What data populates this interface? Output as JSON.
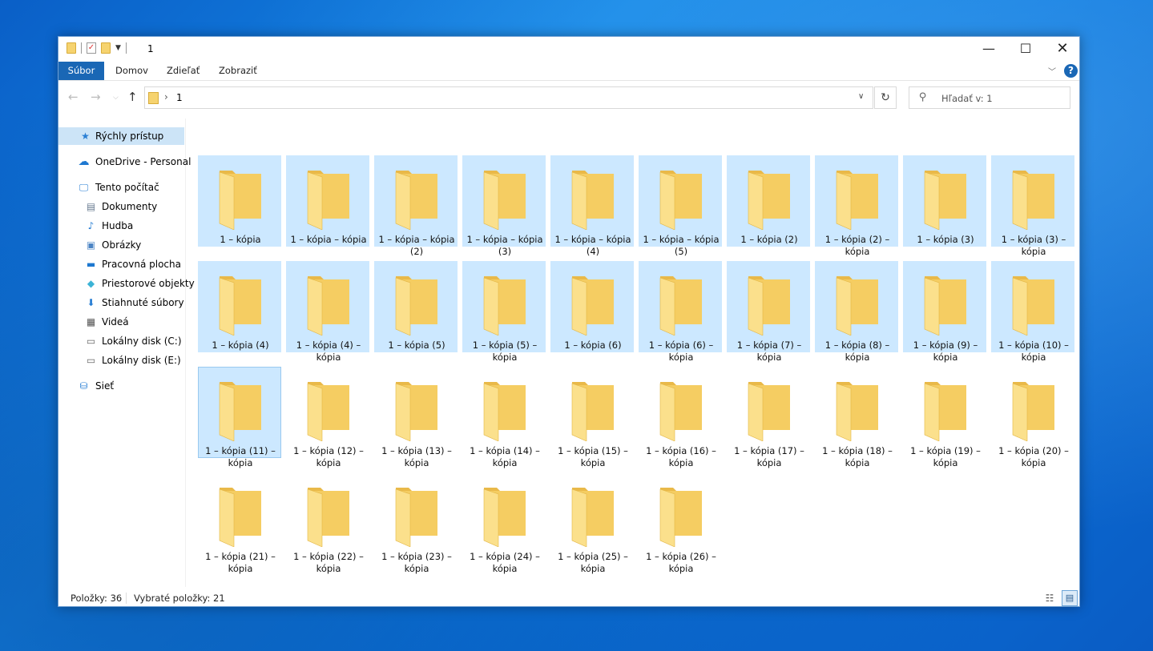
{
  "window": {
    "title": "1"
  },
  "ribbon": {
    "tabs": [
      "Súbor",
      "Domov",
      "Zdieľať",
      "Zobraziť"
    ]
  },
  "address": {
    "path": "1",
    "search_placeholder": "Hľadať v: 1"
  },
  "sidebar": {
    "items": [
      {
        "label": "Rýchly prístup",
        "icon": "star-icon"
      },
      {
        "label": "OneDrive - Personal",
        "icon": "cloud-icon"
      },
      {
        "label": "Tento počítač",
        "icon": "computer-icon"
      },
      {
        "label": "Dokumenty",
        "icon": "document-icon"
      },
      {
        "label": "Hudba",
        "icon": "music-icon"
      },
      {
        "label": "Obrázky",
        "icon": "picture-icon"
      },
      {
        "label": "Pracovná plocha",
        "icon": "desktop-icon"
      },
      {
        "label": "Priestorové objekty",
        "icon": "cube-icon"
      },
      {
        "label": "Stiahnuté súbory",
        "icon": "download-icon"
      },
      {
        "label": "Videá",
        "icon": "video-icon"
      },
      {
        "label": "Lokálny disk (C:)",
        "icon": "drive-icon"
      },
      {
        "label": "Lokálny disk (E:)",
        "icon": "drive-icon"
      },
      {
        "label": "Sieť",
        "icon": "network-icon"
      }
    ]
  },
  "folders": [
    {
      "name": "1 – kópia",
      "selected": true
    },
    {
      "name": "1 – kópia – kópia",
      "selected": true
    },
    {
      "name": "1 – kópia – kópia (2)",
      "selected": true
    },
    {
      "name": "1 – kópia – kópia (3)",
      "selected": true
    },
    {
      "name": "1 – kópia – kópia (4)",
      "selected": true
    },
    {
      "name": "1 – kópia – kópia (5)",
      "selected": true
    },
    {
      "name": "1 – kópia (2)",
      "selected": true
    },
    {
      "name": "1 – kópia (2) – kópia",
      "selected": true
    },
    {
      "name": "1 – kópia (3)",
      "selected": true
    },
    {
      "name": "1 – kópia (3) – kópia",
      "selected": true
    },
    {
      "name": "1 – kópia (4)",
      "selected": true
    },
    {
      "name": "1 – kópia (4) – kópia",
      "selected": true
    },
    {
      "name": "1 – kópia (5)",
      "selected": true
    },
    {
      "name": "1 – kópia (5) – kópia",
      "selected": true
    },
    {
      "name": "1 – kópia (6)",
      "selected": true
    },
    {
      "name": "1 – kópia (6) – kópia",
      "selected": true
    },
    {
      "name": "1 – kópia (7) – kópia",
      "selected": true
    },
    {
      "name": "1 – kópia (8) – kópia",
      "selected": true
    },
    {
      "name": "1 – kópia (9) – kópia",
      "selected": true
    },
    {
      "name": "1 – kópia (10) – kópia",
      "selected": true
    },
    {
      "name": "1 – kópia (11) – kópia",
      "selected": true,
      "focused": true
    },
    {
      "name": "1 – kópia (12) – kópia",
      "selected": false
    },
    {
      "name": "1 – kópia (13) – kópia",
      "selected": false
    },
    {
      "name": "1 – kópia (14) – kópia",
      "selected": false
    },
    {
      "name": "1 – kópia (15) – kópia",
      "selected": false
    },
    {
      "name": "1 – kópia (16) – kópia",
      "selected": false
    },
    {
      "name": "1 – kópia (17) – kópia",
      "selected": false
    },
    {
      "name": "1 – kópia (18) – kópia",
      "selected": false
    },
    {
      "name": "1 – kópia (19) – kópia",
      "selected": false
    },
    {
      "name": "1 – kópia (20) – kópia",
      "selected": false
    },
    {
      "name": "1 – kópia (21) – kópia",
      "selected": false
    },
    {
      "name": "1 – kópia (22) – kópia",
      "selected": false
    },
    {
      "name": "1 – kópia (23) – kópia",
      "selected": false
    },
    {
      "name": "1 – kópia (24) – kópia",
      "selected": false
    },
    {
      "name": "1 – kópia (25) – kópia",
      "selected": false
    },
    {
      "name": "1 – kópia (26) – kópia",
      "selected": false
    }
  ],
  "status": {
    "item_count": "Položky: 36",
    "selected_count": "Vybraté položky: 21"
  },
  "colors": {
    "accent": "#1a67b5",
    "selection": "#cce8ff",
    "folder": "#f6d36f"
  }
}
